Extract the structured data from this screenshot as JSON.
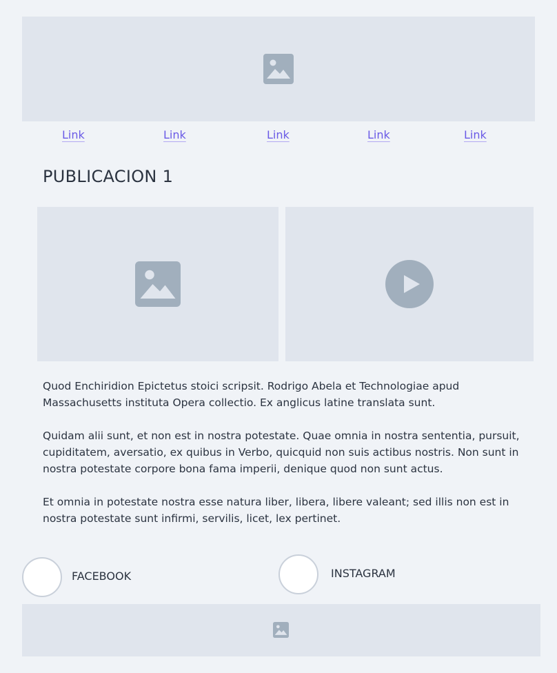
{
  "header": {
    "banner_icon": "image-icon"
  },
  "nav": {
    "links": [
      {
        "label": "Link"
      },
      {
        "label": "Link"
      },
      {
        "label": "Link"
      },
      {
        "label": "Link"
      },
      {
        "label": "Link"
      }
    ]
  },
  "post": {
    "title": "PUBLICACION 1",
    "image_icon": "image-icon",
    "video_icon": "play-icon",
    "paragraphs": [
      "Quod Enchiridion Epictetus stoici scripsit. Rodrigo Abela et Technologiae apud Massachusetts instituta Opera collectio. Ex anglicus latine translata sunt.",
      "Quidam alii sunt, et non est in nostra potestate. Quae omnia in nostra sententia, pursuit, cupiditatem, aversatio, ex quibus in Verbo, quicquid non suis actibus nostris. Non sunt in nostra potestate corpore bona fama imperii, denique quod non sunt actus.",
      "Et omnia in potestate nostra esse natura liber, libera, libere valeant; sed illis non est in nostra potestate sunt infirmi, servilis, licet, lex pertinet."
    ]
  },
  "social": {
    "facebook_label": "FACEBOOK",
    "instagram_label": "INSTAGRAM"
  },
  "footer": {
    "icon": "image-icon"
  },
  "colors": {
    "background": "#f0f3f7",
    "placeholder": "#e0e5ed",
    "icon": "#a1afbd",
    "link": "#6a5ae6",
    "text": "#2b3340"
  }
}
